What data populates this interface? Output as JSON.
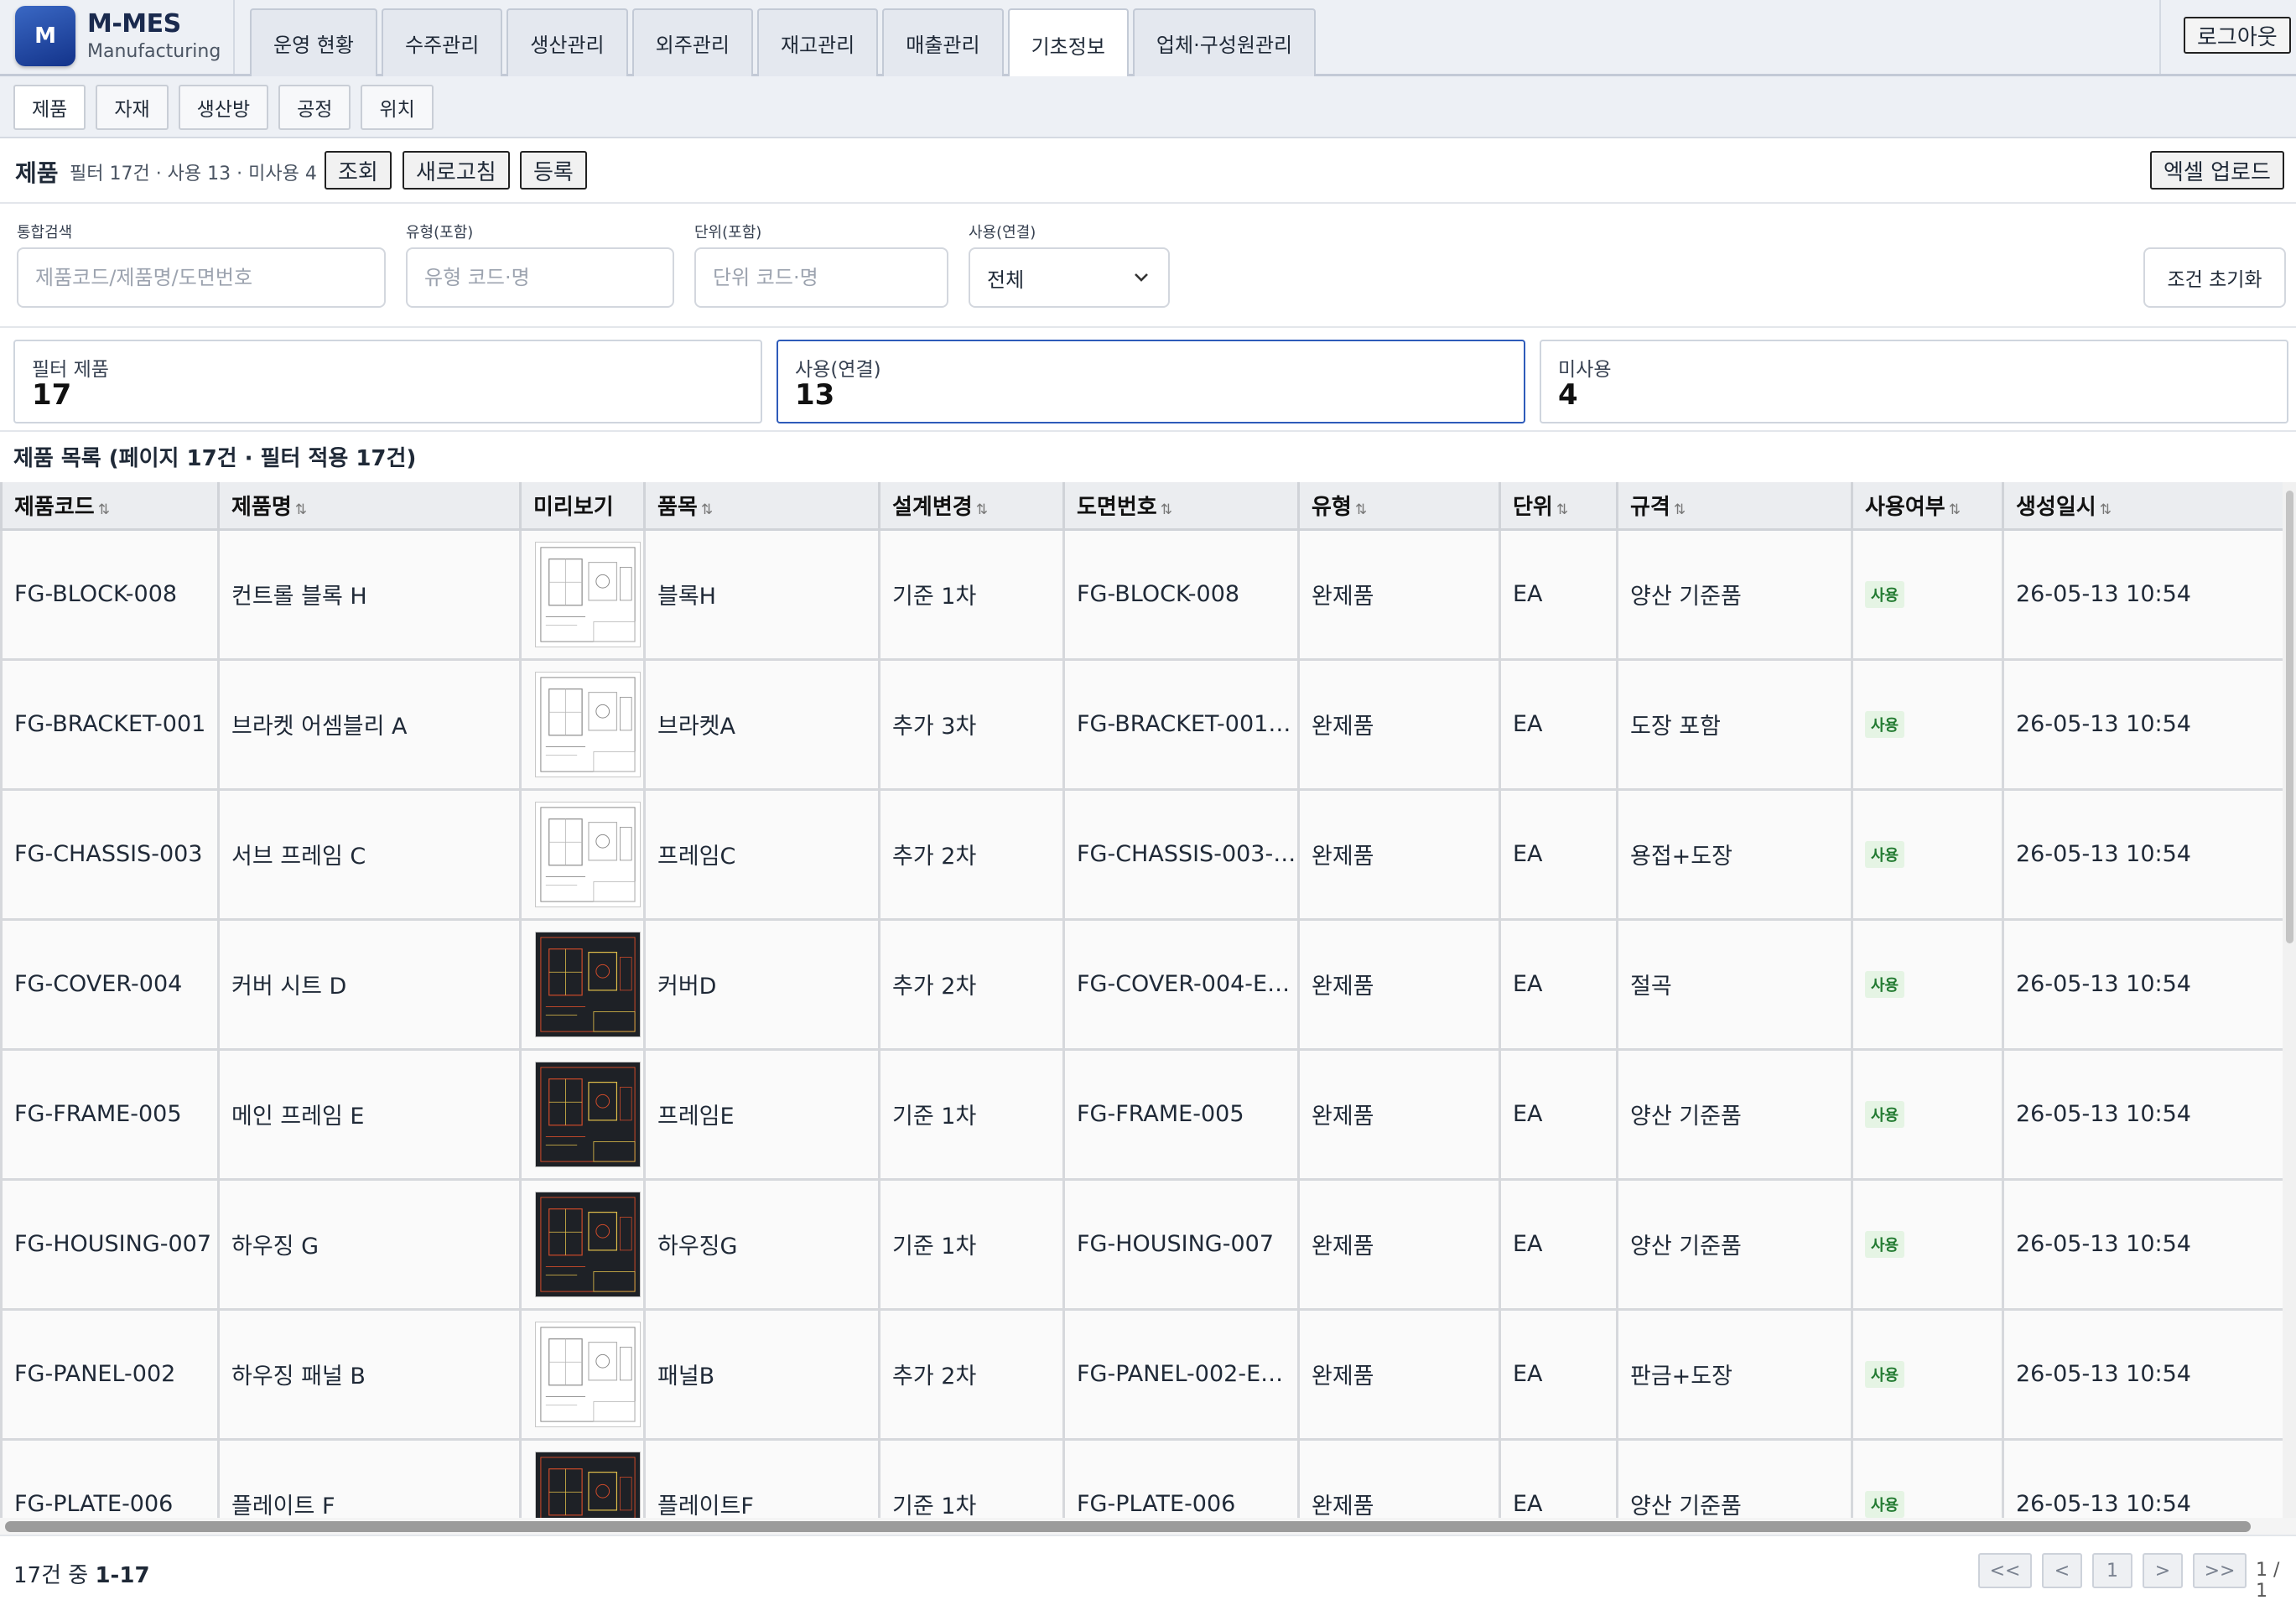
{
  "app": {
    "logo_letter": "M",
    "name": "M-MES",
    "subtitle": "Manufacturing"
  },
  "main_tabs": [
    "운영 현황",
    "수주관리",
    "생산관리",
    "외주관리",
    "재고관리",
    "매출관리",
    "기초정보",
    "업체·구성원관리"
  ],
  "active_main_tab": "기초정보",
  "logout_label": "로그아웃",
  "sub_tabs": [
    "제품",
    "자재",
    "생산방",
    "공정",
    "위치"
  ],
  "active_sub_tab": "제품",
  "toolbar": {
    "title": "제품",
    "stats": "필터 17건 · 사용 13 · 미사용 4",
    "search_label": "조회",
    "refresh_label": "새로고침",
    "register_label": "등록",
    "excel_label": "엑셀 업로드"
  },
  "filters": {
    "search": {
      "label": "통합검색",
      "placeholder": "제품코드/제품명/도면번호",
      "value": ""
    },
    "type": {
      "label": "유형(포함)",
      "placeholder": "유형 코드·명",
      "value": ""
    },
    "unit": {
      "label": "단위(포함)",
      "placeholder": "단위 코드·명",
      "value": ""
    },
    "usage": {
      "label": "사용(연결)",
      "value": "전체"
    },
    "reset_label": "조건 초기화"
  },
  "summary": {
    "filtered": {
      "label": "필터 제품",
      "value": "17"
    },
    "used": {
      "label": "사용(연결)",
      "value": "13"
    },
    "unused": {
      "label": "미사용",
      "value": "4"
    }
  },
  "list_title": "제품 목록 (페이지 17건 · 필터 적용 17건)",
  "table": {
    "columns": [
      "제품코드",
      "제품명",
      "미리보기",
      "품목",
      "설계변경",
      "도면번호",
      "유형",
      "단위",
      "규격",
      "사용여부",
      "생성일시"
    ],
    "rows": [
      {
        "code": "FG-BLOCK-008",
        "name": "컨트롤 블록 H",
        "preview": "light",
        "item": "블록H",
        "design": "기준 1차",
        "drawing": "FG-BLOCK-008",
        "type": "완제품",
        "unit": "EA",
        "spec": "양산 기준품",
        "status": "사용",
        "created": "26-05-13 10:54"
      },
      {
        "code": "FG-BRACKET-001",
        "name": "브라켓 어셈블리 A",
        "preview": "light",
        "item": "브라켓A",
        "design": "추가 3차",
        "drawing": "FG-BRACKET-001-…",
        "type": "완제품",
        "unit": "EA",
        "spec": "도장 포함",
        "status": "사용",
        "created": "26-05-13 10:54"
      },
      {
        "code": "FG-CHASSIS-003",
        "name": "서브 프레임 C",
        "preview": "light",
        "item": "프레임C",
        "design": "추가 2차",
        "drawing": "FG-CHASSIS-003-…",
        "type": "완제품",
        "unit": "EA",
        "spec": "용접+도장",
        "status": "사용",
        "created": "26-05-13 10:54"
      },
      {
        "code": "FG-COVER-004",
        "name": "커버 시트 D",
        "preview": "dark",
        "item": "커버D",
        "design": "추가 2차",
        "drawing": "FG-COVER-004-E…",
        "type": "완제품",
        "unit": "EA",
        "spec": "절곡",
        "status": "사용",
        "created": "26-05-13 10:54"
      },
      {
        "code": "FG-FRAME-005",
        "name": "메인 프레임 E",
        "preview": "dark",
        "item": "프레임E",
        "design": "기준 1차",
        "drawing": "FG-FRAME-005",
        "type": "완제품",
        "unit": "EA",
        "spec": "양산 기준품",
        "status": "사용",
        "created": "26-05-13 10:54"
      },
      {
        "code": "FG-HOUSING-007",
        "name": "하우징 G",
        "preview": "dark",
        "item": "하우징G",
        "design": "기준 1차",
        "drawing": "FG-HOUSING-007",
        "type": "완제품",
        "unit": "EA",
        "spec": "양산 기준품",
        "status": "사용",
        "created": "26-05-13 10:54"
      },
      {
        "code": "FG-PANEL-002",
        "name": "하우징 패널 B",
        "preview": "light",
        "item": "패널B",
        "design": "추가 2차",
        "drawing": "FG-PANEL-002-E…",
        "type": "완제품",
        "unit": "EA",
        "spec": "판금+도장",
        "status": "사용",
        "created": "26-05-13 10:54"
      },
      {
        "code": "FG-PLATE-006",
        "name": "플레이트 F",
        "preview": "dark",
        "item": "플레이트F",
        "design": "기준 1차",
        "drawing": "FG-PLATE-006",
        "type": "완제품",
        "unit": "EA",
        "spec": "양산 기준품",
        "status": "사용",
        "created": "26-05-13 10:54"
      }
    ]
  },
  "footer": {
    "count_prefix": "17건 중 ",
    "count_range": "1-17",
    "first": "<<",
    "prev": "<",
    "current": "1",
    "next": ">",
    "last": ">>",
    "page_info": "1 / 1"
  }
}
